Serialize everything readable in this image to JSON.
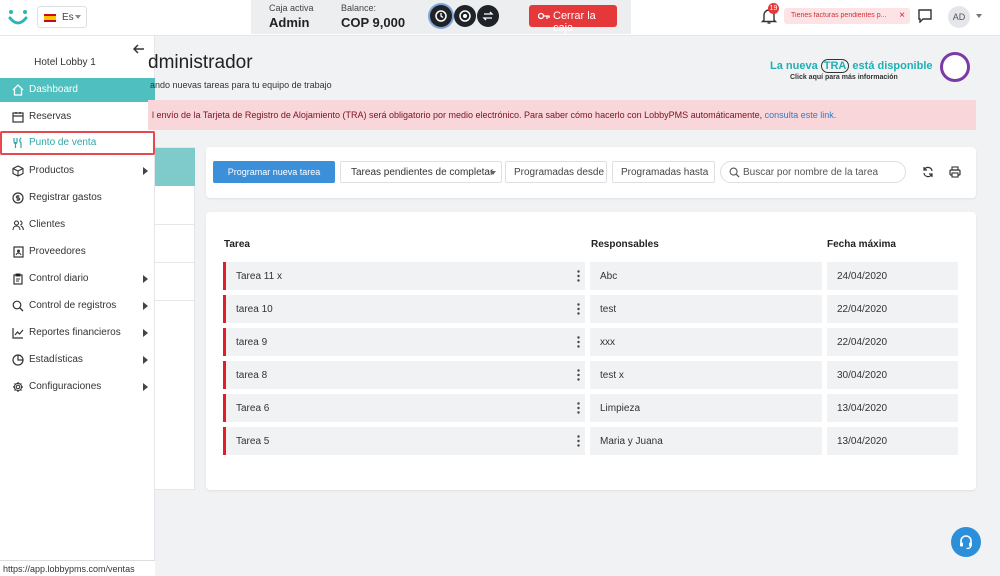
{
  "header": {
    "language": "Es",
    "caja_label": "Caja activa",
    "caja_value": "Admin",
    "balance_label": "Balance:",
    "balance_value": "COP 9,000",
    "close_button": "Cerrar la caja",
    "notif_count": "19",
    "alert_text": "Tienes facturas pendientes p...",
    "alert_close": "×",
    "avatar_initials": "AD"
  },
  "sidebar": {
    "hotel_name": "Hotel Lobby 1",
    "items": [
      {
        "label": "Dashboard",
        "icon": "home-icon",
        "active": true,
        "has_children": false
      },
      {
        "label": "Reservas",
        "icon": "calendar-icon",
        "has_children": false
      },
      {
        "label": "Punto de venta",
        "icon": "utensils-icon",
        "highlighted": true,
        "has_children": false
      },
      {
        "label": "Productos",
        "icon": "box-icon",
        "has_children": true
      },
      {
        "label": "Registrar gastos",
        "icon": "dollar-icon",
        "has_children": false
      },
      {
        "label": "Clientes",
        "icon": "users-icon",
        "has_children": false
      },
      {
        "label": "Proveedores",
        "icon": "contact-book-icon",
        "has_children": false
      },
      {
        "label": "Control diario",
        "icon": "clipboard-icon",
        "has_children": true
      },
      {
        "label": "Control de registros",
        "icon": "search-icon",
        "has_children": true
      },
      {
        "label": "Reportes financieros",
        "icon": "line-chart-icon",
        "has_children": true
      },
      {
        "label": "Estadísticas",
        "icon": "pie-chart-icon",
        "has_children": true
      },
      {
        "label": "Configuraciones",
        "icon": "gear-icon",
        "has_children": true
      }
    ]
  },
  "status_url": "https://app.lobbypms.com/ventas",
  "page": {
    "title": "dministrador",
    "subtitle": "ando nuevas tareas para tu equipo de trabajo"
  },
  "promo": {
    "line1_a": "La nueva",
    "line1_b": "TRA",
    "line1_c": "está disponible",
    "line2": "Click aquí para más información"
  },
  "banner": {
    "text": "l envío de la Tarjeta de Registro de Alojamiento (TRA) será obligatorio por medio electrónico. Para saber cómo hacerlo con LobbyPMS automáticamente,",
    "link": "consulta este link."
  },
  "toolbar": {
    "new_task_button": "Programar nueva tarea",
    "filter_selected": "Tareas pendientes de completar",
    "date_from_placeholder": "Programadas desde",
    "date_to_placeholder": "Programadas hasta",
    "search_placeholder": "Buscar por nombre de la tarea"
  },
  "table": {
    "headers": {
      "task": "Tarea",
      "responsible": "Responsables",
      "due": "Fecha máxima"
    },
    "rows": [
      {
        "task": "Tarea 11 x",
        "responsible": "Abc",
        "due": "24/04/2020"
      },
      {
        "task": "tarea 10",
        "responsible": "test",
        "due": "22/04/2020"
      },
      {
        "task": "tarea 9",
        "responsible": "xxx",
        "due": "22/04/2020"
      },
      {
        "task": "tarea 8",
        "responsible": "test x",
        "due": "30/04/2020"
      },
      {
        "task": "Tarea 6",
        "responsible": "Limpieza",
        "due": "13/04/2020"
      },
      {
        "task": "Tarea 5",
        "responsible": "Maria y Juana",
        "due": "13/04/2020"
      }
    ]
  },
  "colors": {
    "accent": "#4fbfc0",
    "primary_button": "#3c8fd9",
    "danger": "#e5383b",
    "banner_bg": "#f8d6da",
    "row_marker": "#e21c2b"
  }
}
